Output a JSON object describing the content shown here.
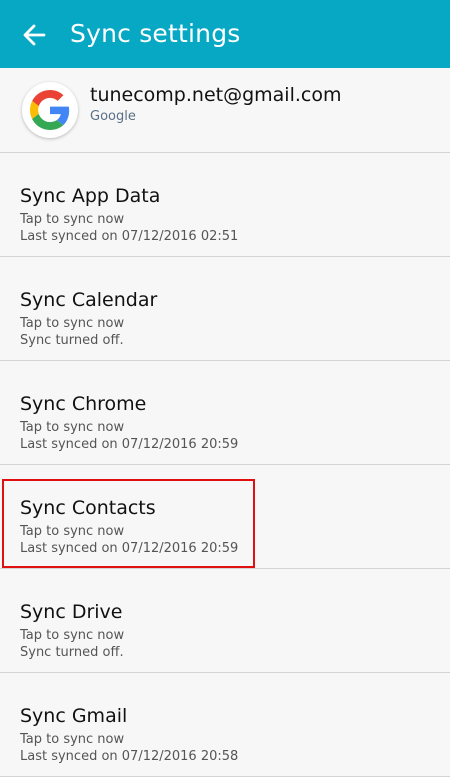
{
  "header": {
    "title": "Sync settings",
    "back_icon": "arrow-left-icon",
    "background_color": "#06a8c4"
  },
  "account": {
    "email": "tunecomp.net@gmail.com",
    "type": "Google",
    "icon": "google-g-icon"
  },
  "sync_items": [
    {
      "title": "Sync App Data",
      "action": "Tap to sync now",
      "status": "Last synced on 07/12/2016 02:51"
    },
    {
      "title": "Sync Calendar",
      "action": "Tap to sync now",
      "status": "Sync turned off."
    },
    {
      "title": "Sync Chrome",
      "action": "Tap to sync now",
      "status": "Last synced on 07/12/2016 20:59"
    },
    {
      "title": "Sync Contacts",
      "action": "Tap to sync now",
      "status": "Last synced on 07/12/2016 20:59",
      "highlighted": true
    },
    {
      "title": "Sync Drive",
      "action": "Tap to sync now",
      "status": "Sync turned off."
    },
    {
      "title": "Sync Gmail",
      "action": "Tap to sync now",
      "status": "Last synced on 07/12/2016 20:58"
    }
  ],
  "highlight_color": "#e01010"
}
